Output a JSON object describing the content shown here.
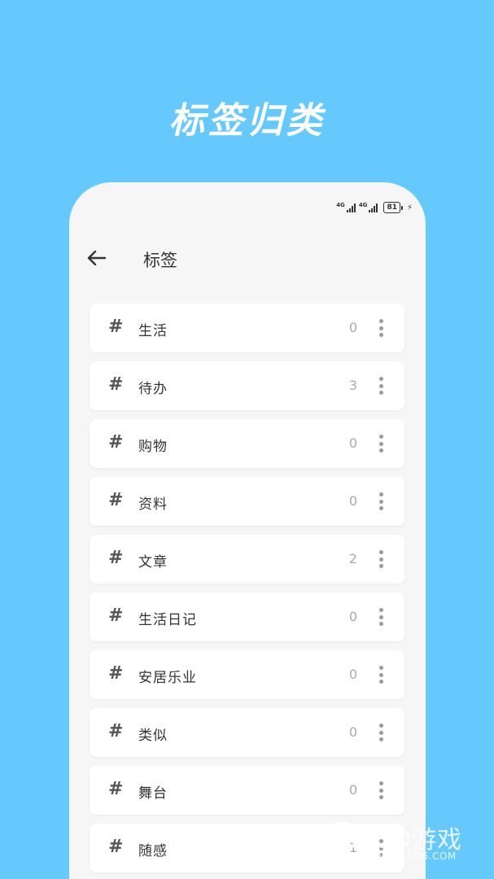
{
  "promo": {
    "title": "标签归类"
  },
  "status_bar": {
    "signal_1_label": "4G",
    "signal_2_label": "4G",
    "battery_level": "81",
    "charging_icon": "bolt-icon"
  },
  "header": {
    "back_icon": "arrow-left-icon",
    "title": "标签"
  },
  "tags": [
    {
      "hash": "#",
      "name": "生活",
      "count": "0"
    },
    {
      "hash": "#",
      "name": "待办",
      "count": "3"
    },
    {
      "hash": "#",
      "name": "购物",
      "count": "0"
    },
    {
      "hash": "#",
      "name": "资料",
      "count": "0"
    },
    {
      "hash": "#",
      "name": "文章",
      "count": "2"
    },
    {
      "hash": "#",
      "name": "生活日记",
      "count": "0"
    },
    {
      "hash": "#",
      "name": "安居乐业",
      "count": "0"
    },
    {
      "hash": "#",
      "name": "类似",
      "count": "0"
    },
    {
      "hash": "#",
      "name": "舞台",
      "count": "0"
    },
    {
      "hash": "#",
      "name": "随感",
      "count": "1"
    }
  ],
  "watermark": {
    "brand": "CD游戏",
    "url": "WWW.CD6.COM"
  },
  "colors": {
    "background": "#66c9fe",
    "card": "#ffffff",
    "screen": "#f6f6f6",
    "count": "#aaaaaa"
  }
}
